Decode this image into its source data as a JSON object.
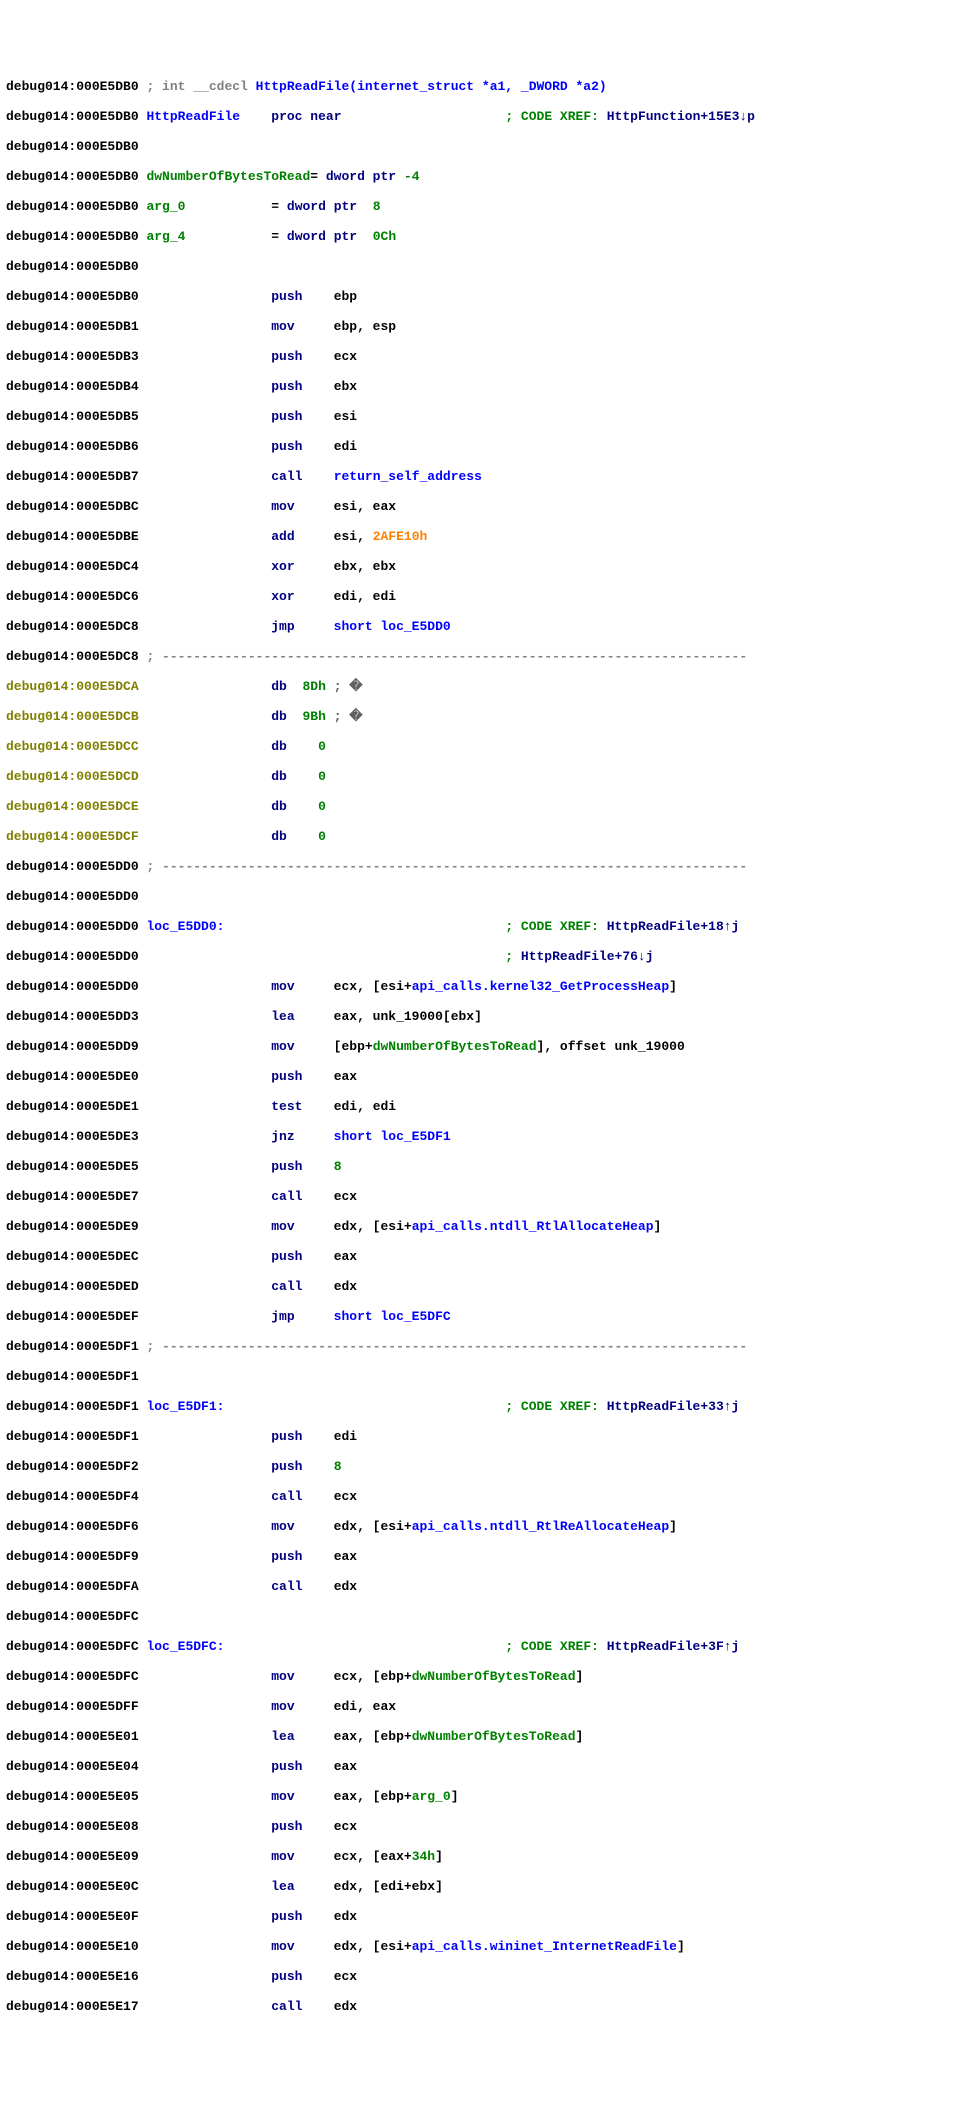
{
  "sig_prefix": "; int __cdecl ",
  "sig_fn": "HttpReadFile(internet_struct *a1, _DWORD *a2)",
  "procname": "HttpReadFile",
  "proc": "proc near",
  "xref_hdr": "; CODE XREF: ",
  "xref_fn0": "HttpFunction+15E3↓p",
  "xref_fn1": "HttpReadFile+18↑j",
  "xref_fn2": "HttpReadFile+76↓j",
  "xref_fn3": "HttpReadFile+33↑j",
  "xref_fn4": "HttpReadFile+3F↑j",
  "var_dw": "dwNumberOfBytesToRead",
  "eq": "= ",
  "dw1": "dword ptr",
  "off_m4": "-4",
  "off_8": "8",
  "off_c": "0Ch",
  "arg0": "arg_0",
  "arg4": "arg_4",
  "dashline": "---------------------------------------------------------------------------",
  "loc1": "loc_E5DD0:",
  "loc2": "loc_E5DF1:",
  "loc3": "loc_E5DFC:",
  "m": {
    "push": "push",
    "mov": "mov",
    "call": "call",
    "add": "add",
    "xor": "xor",
    "jmp": "jmp",
    "db": "db",
    "lea": "lea",
    "test": "test",
    "jnz": "jnz"
  },
  "ops": {
    "ebp": "ebp",
    "ebp_esp": "ebp, esp",
    "ecx": "ecx",
    "ebx": "ebx",
    "esi": "esi",
    "edi": "edi",
    "eax": "eax",
    "edx": "edx",
    "esi_eax": "esi, eax",
    "ebx_ebx": "ebx, ebx",
    "edi_edi": "edi, edi",
    "edi_eax": "edi, eax",
    "ret_self": "return_self_address",
    "short_dd0": "short loc_E5DD0",
    "short_df1": "short loc_E5DF1",
    "short_dfc": "short loc_E5DFC",
    "imm2af": "2AFE10h",
    "imm8": "8",
    "imm34": "34h",
    "ecx_esi_heap": "ecx, [esi+",
    "api_heap": "api_calls.kernel32_GetProcessHeap",
    "bracket_close": "]",
    "lea_eax_unk": "eax, unk_19000[ebx]",
    "mov_ebp_dw_pre": "[ebp+",
    "mov_ebp_dw_suf": "], offset unk_19000",
    "testedi": "edi, edi",
    "edx_esi_pre": "edx, [esi+",
    "api_alloc": "api_calls.ntdll_RtlAllocateHeap",
    "api_realloc": "api_calls.ntdll_RtlReAllocateHeap",
    "api_irf": "api_calls.wininet_InternetReadFile",
    "ecx_ebp_pre": "ecx, [ebp+",
    "eax_ebp_pre": "eax, [ebp+",
    "lea_eax_ebp_pre": "eax, [ebp+",
    "ecx_eax_34": "ecx, [eax+",
    "lea_edx_ediebx": "edx, [edi+ebx]",
    "db8d": "8Dh",
    "db9b": "9Bh",
    "db0": "0",
    "glyph": "; �"
  },
  "addr": {
    "a0": "debug014:000E5DB0",
    "a1": "debug014:000E5DB1",
    "a3": "debug014:000E5DB3",
    "a4": "debug014:000E5DB4",
    "a5": "debug014:000E5DB5",
    "a6": "debug014:000E5DB6",
    "a7": "debug014:000E5DB7",
    "bc": "debug014:000E5DBC",
    "be": "debug014:000E5DBE",
    "c4": "debug014:000E5DC4",
    "c6": "debug014:000E5DC6",
    "c8": "debug014:000E5DC8",
    "ca": "debug014:000E5DCA",
    "cb": "debug014:000E5DCB",
    "cc": "debug014:000E5DCC",
    "cd": "debug014:000E5DCD",
    "ce": "debug014:000E5DCE",
    "cf": "debug014:000E5DCF",
    "d0": "debug014:000E5DD0",
    "d3": "debug014:000E5DD3",
    "d9": "debug014:000E5DD9",
    "e0": "debug014:000E5DE0",
    "e1": "debug014:000E5DE1",
    "e3": "debug014:000E5DE3",
    "e5": "debug014:000E5DE5",
    "e7": "debug014:000E5DE7",
    "e9": "debug014:000E5DE9",
    "ec": "debug014:000E5DEC",
    "ed": "debug014:000E5DED",
    "ef": "debug014:000E5DEF",
    "f1": "debug014:000E5DF1",
    "f2": "debug014:000E5DF2",
    "f4": "debug014:000E5DF4",
    "f6": "debug014:000E5DF6",
    "f9": "debug014:000E5DF9",
    "fa": "debug014:000E5DFA",
    "fc": "debug014:000E5DFC",
    "ff": "debug014:000E5DFF",
    "e01": "debug014:000E5E01",
    "e04": "debug014:000E5E04",
    "e05": "debug014:000E5E05",
    "e08": "debug014:000E5E08",
    "e09": "debug014:000E5E09",
    "e0c": "debug014:000E5E0C",
    "e0f": "debug014:000E5E0F",
    "e10": "debug014:000E5E10",
    "e16": "debug014:000E5E16",
    "e17": "debug014:000E5E17"
  }
}
